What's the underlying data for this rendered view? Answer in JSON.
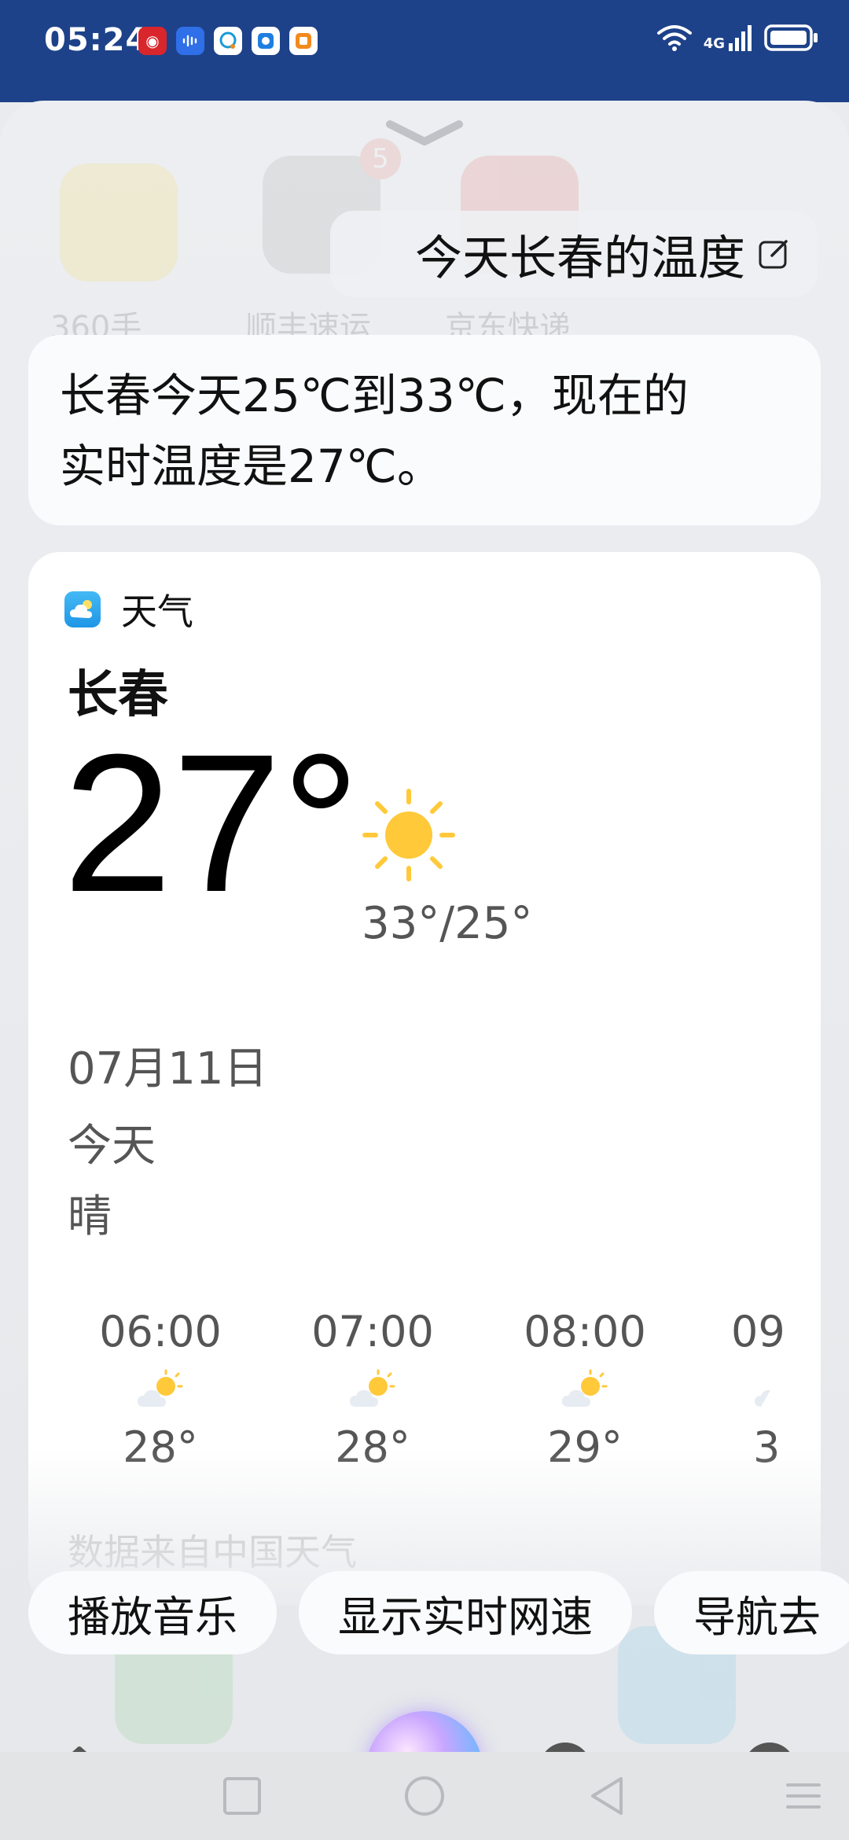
{
  "status_bar": {
    "time": "05:24",
    "network": "4G",
    "app_icons": [
      "app-red-icon",
      "voice-assistant-icon",
      "chat-icon",
      "app-blue-icon",
      "app-orange-icon"
    ]
  },
  "query": {
    "text": "今天长春的温度"
  },
  "answer": {
    "line1": "长春今天25℃到33℃，现在的",
    "line2": "实时温度是27℃。"
  },
  "weather": {
    "app_name": "天气",
    "city": "长春",
    "current_temp": "27°",
    "range": "33°/25°",
    "date": "07月11日",
    "day": "今天",
    "condition": "晴",
    "hourly": [
      {
        "time": "06:00",
        "temp": "28°"
      },
      {
        "time": "07:00",
        "temp": "28°"
      },
      {
        "time": "08:00",
        "temp": "29°"
      },
      {
        "time": "09",
        "temp": "3"
      }
    ],
    "source": "数据来自中国天气"
  },
  "suggestions": [
    "播放音乐",
    "显示实时网速",
    "导航去"
  ],
  "colors": {
    "status_bar": "#1d4289",
    "sun": "#ffc93a",
    "accent_app": "#2aa4ef"
  }
}
